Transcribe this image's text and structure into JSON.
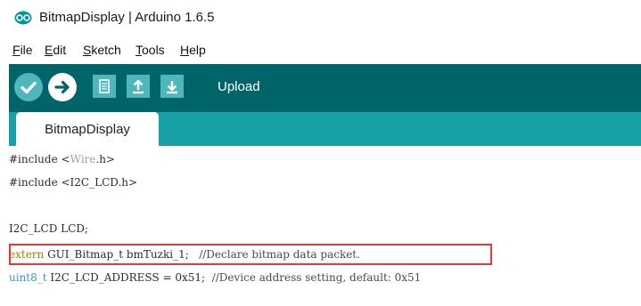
{
  "window": {
    "title": "BitmapDisplay | Arduino 1.6.5"
  },
  "menu": {
    "items": [
      {
        "key": "file",
        "underline": "F",
        "rest": "ile"
      },
      {
        "key": "edit",
        "underline": "E",
        "rest": "dit"
      },
      {
        "key": "sketch",
        "underline": "S",
        "rest": "ketch"
      },
      {
        "key": "tools",
        "underline": "T",
        "rest": "ools"
      },
      {
        "key": "help",
        "underline": "H",
        "rest": "elp"
      }
    ]
  },
  "toolbar": {
    "hover_label": "Upload",
    "buttons": [
      {
        "name": "verify-icon"
      },
      {
        "name": "upload-icon"
      },
      {
        "name": "new-icon"
      },
      {
        "name": "open-icon"
      },
      {
        "name": "save-icon"
      }
    ],
    "colors": {
      "toolbar_bg": "#006468",
      "button_bg": "#4db7bb",
      "tabbar_bg": "#17a1a5"
    }
  },
  "tabs": [
    {
      "label": "BitmapDisplay"
    }
  ],
  "code": {
    "line1": {
      "kw": "#include",
      "open": " <",
      "file": "Wire",
      "rest": ".h>"
    },
    "line2": {
      "text": "#include <I2C_LCD.h>"
    },
    "line3": {
      "text": "I2C_LCD LCD;"
    },
    "line4": {
      "kw": "extern",
      "decl": " GUI_Bitmap_t bmTuzki_1;",
      "comment": "   //Declare bitmap data packet."
    },
    "line5": {
      "ty": "uint8_t",
      "decl": " I2C_LCD_ADDRESS = 0x51;",
      "comment": "  //Device address setting, default: 0x51"
    }
  },
  "highlight_color": "#e53935"
}
